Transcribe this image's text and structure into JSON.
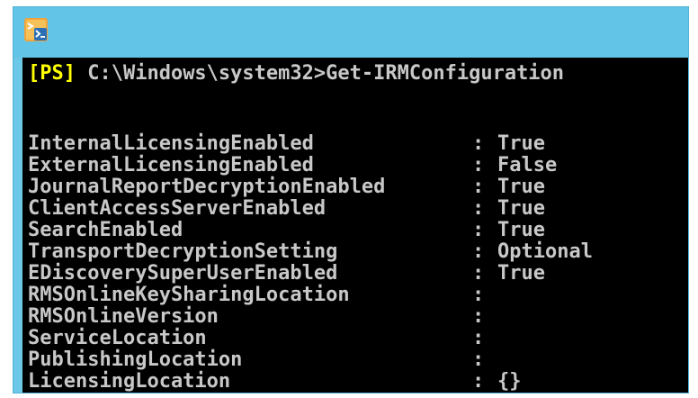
{
  "window": {
    "icon": "powershell-icon"
  },
  "console": {
    "prompt_tag": "[PS]",
    "prompt_path": " C:\\Windows\\system32>",
    "command": "Get-IRMConfiguration",
    "separator": ":",
    "rows": [
      {
        "key": "InternalLicensingEnabled",
        "value": "True"
      },
      {
        "key": "ExternalLicensingEnabled",
        "value": "False"
      },
      {
        "key": "JournalReportDecryptionEnabled",
        "value": "True"
      },
      {
        "key": "ClientAccessServerEnabled",
        "value": "True"
      },
      {
        "key": "SearchEnabled",
        "value": "True"
      },
      {
        "key": "TransportDecryptionSetting",
        "value": "Optional"
      },
      {
        "key": "EDiscoverySuperUserEnabled",
        "value": "True"
      },
      {
        "key": "RMSOnlineKeySharingLocation",
        "value": ""
      },
      {
        "key": "RMSOnlineVersion",
        "value": ""
      },
      {
        "key": "ServiceLocation",
        "value": ""
      },
      {
        "key": "PublishingLocation",
        "value": ""
      },
      {
        "key": "LicensingLocation",
        "value": "{}"
      }
    ]
  },
  "colors": {
    "titlebar": "#62c4e6",
    "console_bg": "#000000",
    "console_text": "#c8c8c8",
    "prompt_tag": "#ffff00"
  }
}
